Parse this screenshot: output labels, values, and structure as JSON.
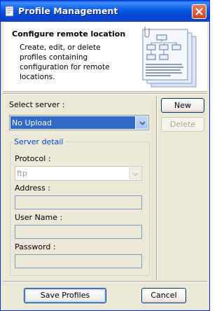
{
  "window": {
    "title": "Profile Management"
  },
  "header": {
    "title": "Configure remote location",
    "description": "Create, edit, or delete profiles containing configuration for remote locations."
  },
  "server": {
    "select_label": "Select server :",
    "selected": "No Upload",
    "new_label": "New",
    "delete_label": "Delete"
  },
  "detail": {
    "group_title": "Server detail",
    "protocol_label": "Protocol :",
    "protocol_value": "ftp",
    "address_label": "Address :",
    "address_value": "",
    "username_label": "User Name :",
    "username_value": "",
    "password_label": "Password :",
    "password_value": ""
  },
  "footer": {
    "save_label": "Save Profiles",
    "cancel_label": "Cancel"
  },
  "colors": {
    "title_bar": "#0a5ee9",
    "selection": "#316ac5",
    "group_title": "#0046d5",
    "dialog_bg": "#ece9d8"
  }
}
